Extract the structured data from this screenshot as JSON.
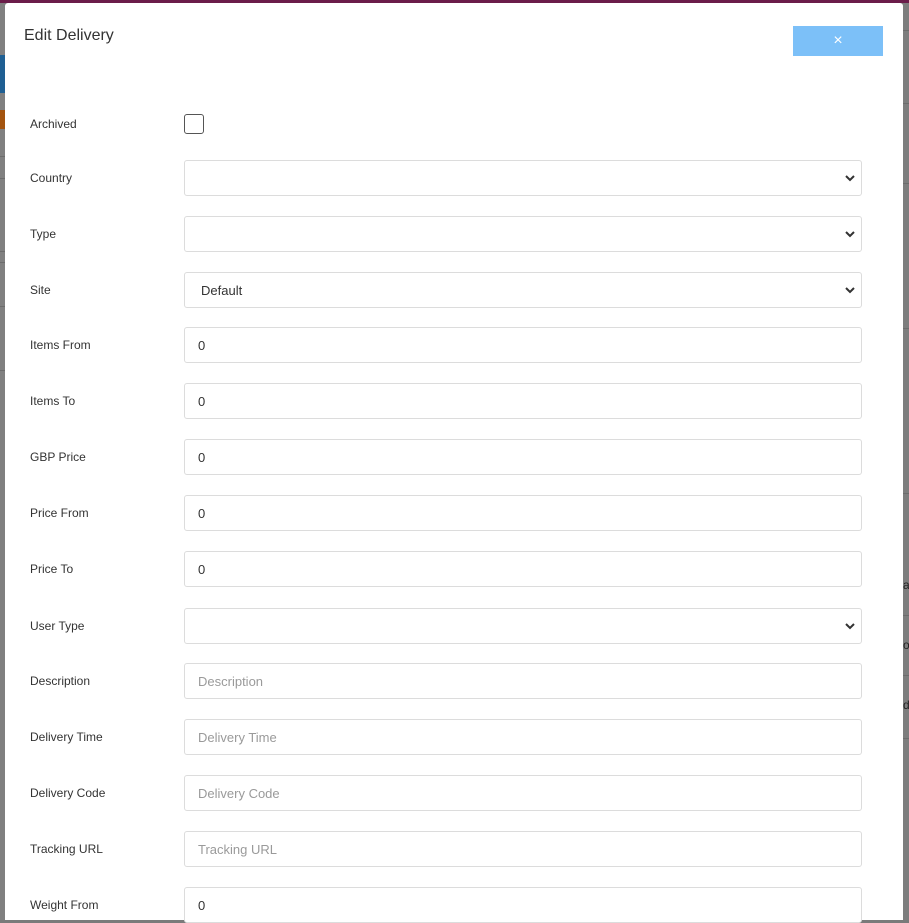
{
  "modal": {
    "title": "Edit Delivery",
    "close_icon": "×",
    "close_color": "#7cc0f8"
  },
  "fields": [
    {
      "label": "Archived",
      "type": "checkbox",
      "checked": false
    },
    {
      "label": "Country",
      "type": "select",
      "value": ""
    },
    {
      "label": "Type",
      "type": "select",
      "value": ""
    },
    {
      "label": "Site",
      "type": "select",
      "value": "Default"
    },
    {
      "label": "Items From",
      "type": "text",
      "value": "0"
    },
    {
      "label": "Items To",
      "type": "text",
      "value": "0"
    },
    {
      "label": "GBP Price",
      "type": "text",
      "value": "0"
    },
    {
      "label": "Price From",
      "type": "text",
      "value": "0"
    },
    {
      "label": "Price To",
      "type": "text",
      "value": "0"
    },
    {
      "label": "User Type",
      "type": "select",
      "value": ""
    },
    {
      "label": "Description",
      "type": "text",
      "value": "",
      "placeholder": "Description"
    },
    {
      "label": "Delivery Time",
      "type": "text",
      "value": "",
      "placeholder": "Delivery Time"
    },
    {
      "label": "Delivery Code",
      "type": "text",
      "value": "",
      "placeholder": "Delivery Code"
    },
    {
      "label": "Tracking URL",
      "type": "text",
      "value": "",
      "placeholder": "Tracking URL"
    },
    {
      "label": "Weight From",
      "type": "text",
      "value": "0"
    }
  ],
  "background": {
    "right_fragments": [
      "ac",
      "ot",
      "de"
    ]
  }
}
